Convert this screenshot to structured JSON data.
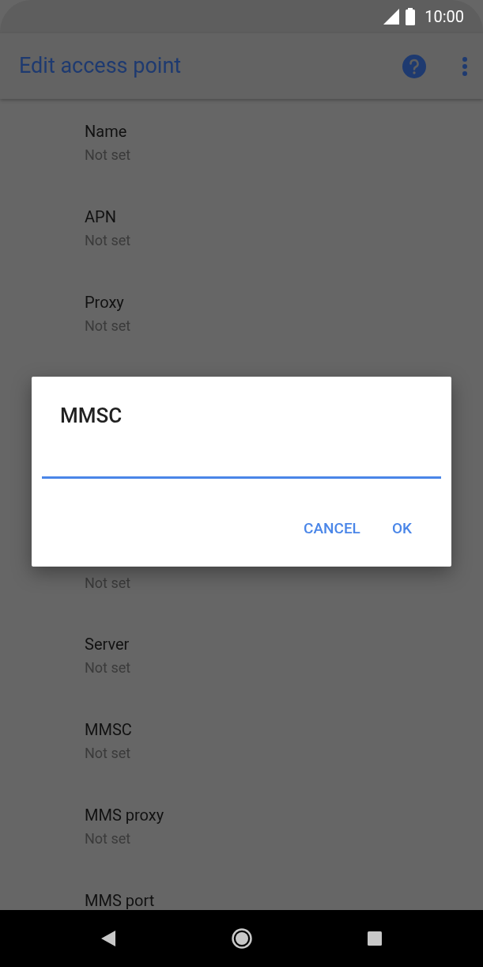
{
  "status_bar": {
    "time": "10:00"
  },
  "app_bar": {
    "title": "Edit access point"
  },
  "settings": [
    {
      "title": "Name",
      "value": "Not set"
    },
    {
      "title": "APN",
      "value": "Not set"
    },
    {
      "title": "Proxy",
      "value": "Not set"
    },
    {
      "value": "Not set"
    },
    {
      "title": "Server",
      "value": "Not set"
    },
    {
      "title": "MMSC",
      "value": "Not set"
    },
    {
      "title": "MMS proxy",
      "value": "Not set"
    },
    {
      "title": "MMS port"
    }
  ],
  "dialog": {
    "title": "MMSC",
    "buttons": [
      "CANCEL",
      "OK"
    ]
  }
}
